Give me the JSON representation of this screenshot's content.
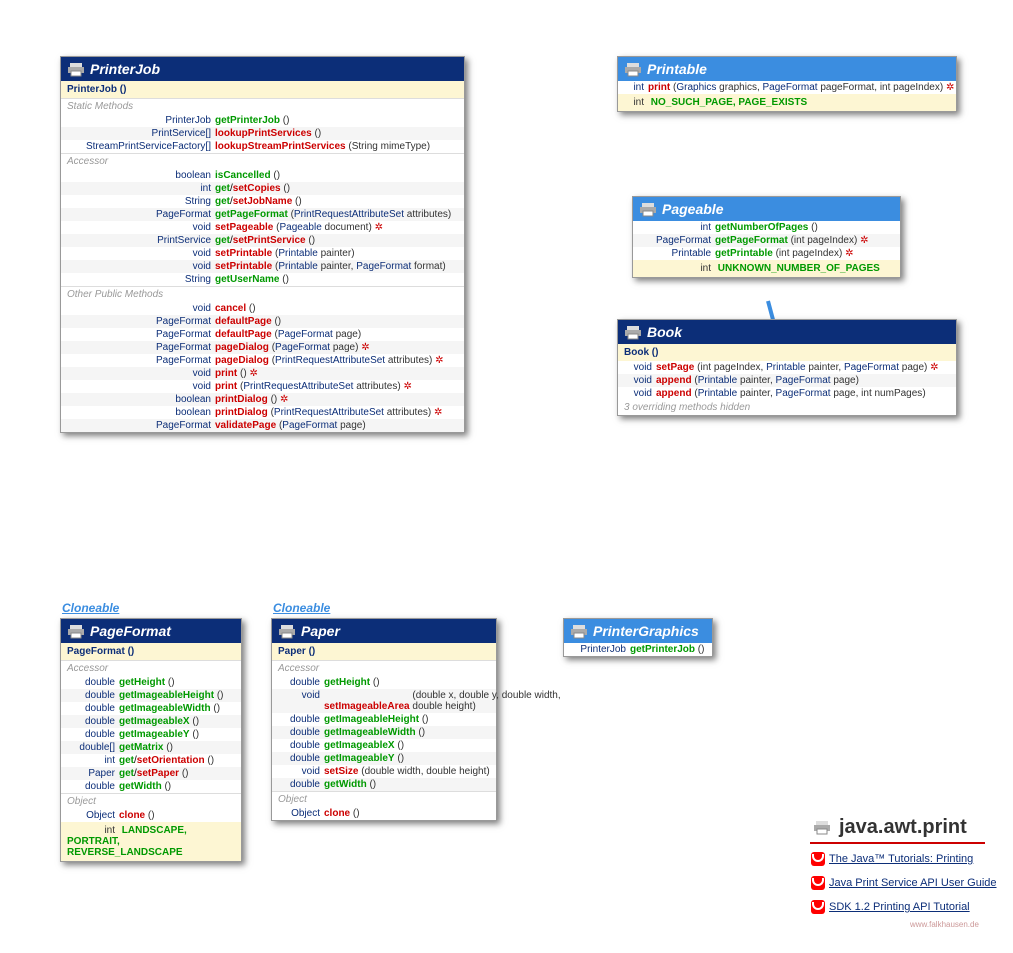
{
  "printerJob": {
    "title": "PrinterJob",
    "ctor": "PrinterJob ()",
    "static": [
      {
        "rt": "PrinterJob",
        "nm": "getPrinterJob",
        "args": "()"
      },
      {
        "rt": "PrintService[]",
        "nm": "lookupPrintServices",
        "args": "()"
      },
      {
        "rt": "StreamPrintServiceFactory[]",
        "nm": "lookupStreamPrintServices",
        "args": "(String mimeType)"
      }
    ],
    "acc": [
      {
        "rt": "boolean",
        "nm": "isCancelled",
        "args": "()"
      },
      {
        "rt": "int",
        "gs": "get/setCopies",
        "args": "()"
      },
      {
        "rt": "String",
        "gs": "get/setJobName",
        "args": "()"
      },
      {
        "rt": "PageFormat",
        "nm": "getPageFormat",
        "args": "(PrintRequestAttributeSet attributes)",
        "t": 1
      },
      {
        "rt": "void",
        "nm": "setPageable",
        "args": "(Pageable document)",
        "t": 1,
        "thr": 1
      },
      {
        "rt": "PrintService",
        "gs": "get/setPrintService",
        "args": "()"
      },
      {
        "rt": "void",
        "nm": "setPrintable",
        "args": "(Printable painter)",
        "t": 1
      },
      {
        "rt": "void",
        "nm": "setPrintable",
        "args": "(Printable painter, PageFormat format)",
        "t": 1
      },
      {
        "rt": "String",
        "nm": "getUserName",
        "args": "()"
      }
    ],
    "other": [
      {
        "rt": "void",
        "nm": "cancel",
        "args": "()"
      },
      {
        "rt": "PageFormat",
        "nm": "defaultPage",
        "args": "()"
      },
      {
        "rt": "PageFormat",
        "nm": "defaultPage",
        "args": "(PageFormat page)",
        "t": 1
      },
      {
        "rt": "PageFormat",
        "nm": "pageDialog",
        "args": "(PageFormat page)",
        "t": 1,
        "thr": 1
      },
      {
        "rt": "PageFormat",
        "nm": "pageDialog",
        "args": "(PrintRequestAttributeSet attributes)",
        "t": 1,
        "thr": 1
      },
      {
        "rt": "void",
        "nm": "print",
        "args": "()",
        "thr": 1
      },
      {
        "rt": "void",
        "nm": "print",
        "args": "(PrintRequestAttributeSet attributes)",
        "t": 1,
        "thr": 1
      },
      {
        "rt": "boolean",
        "nm": "printDialog",
        "args": "()",
        "thr": 1
      },
      {
        "rt": "boolean",
        "nm": "printDialog",
        "args": "(PrintRequestAttributeSet attributes)",
        "t": 1,
        "thr": 1
      },
      {
        "rt": "PageFormat",
        "nm": "validatePage",
        "args": "(PageFormat page)",
        "t": 1
      }
    ]
  },
  "printable": {
    "title": "Printable",
    "m": [
      {
        "rt": "int",
        "nm": "print",
        "args": "(Graphics graphics, PageFormat pageFormat, int pageIndex)",
        "t": 1,
        "thr": 1
      }
    ],
    "const": "NO_SUCH_PAGE, PAGE_EXISTS",
    "crt": "int"
  },
  "pageable": {
    "title": "Pageable",
    "m": [
      {
        "rt": "int",
        "nm": "getNumberOfPages",
        "args": "()"
      },
      {
        "rt": "PageFormat",
        "nm": "getPageFormat",
        "args": "(int pageIndex)",
        "thr": 1
      },
      {
        "rt": "Printable",
        "nm": "getPrintable",
        "args": "(int pageIndex)",
        "thr": 1
      }
    ],
    "const": "UNKNOWN_NUMBER_OF_PAGES",
    "crt": "int"
  },
  "book": {
    "title": "Book",
    "ctor": "Book ()",
    "m": [
      {
        "rt": "void",
        "nm": "setPage",
        "args": "(int pageIndex, Printable painter, PageFormat page)",
        "t": 1,
        "thr": 1
      },
      {
        "rt": "void",
        "nm": "append",
        "args": "(Printable painter, PageFormat page)",
        "t": 1
      },
      {
        "rt": "void",
        "nm": "append",
        "args": "(Printable painter, PageFormat page, int numPages)",
        "t": 1
      }
    ],
    "note": "3 overriding methods hidden"
  },
  "pageFormat": {
    "title": "PageFormat",
    "ctor": "PageFormat ()",
    "tag": "Cloneable",
    "acc": [
      {
        "rt": "double",
        "nm": "getHeight",
        "args": "()"
      },
      {
        "rt": "double",
        "nm": "getImageableHeight",
        "args": "()"
      },
      {
        "rt": "double",
        "nm": "getImageableWidth",
        "args": "()"
      },
      {
        "rt": "double",
        "nm": "getImageableX",
        "args": "()"
      },
      {
        "rt": "double",
        "nm": "getImageableY",
        "args": "()"
      },
      {
        "rt": "double[]",
        "nm": "getMatrix",
        "args": "()"
      },
      {
        "rt": "int",
        "gs": "get/setOrientation",
        "args": "()"
      },
      {
        "rt": "Paper",
        "gs": "get/setPaper",
        "args": "()"
      },
      {
        "rt": "double",
        "nm": "getWidth",
        "args": "()"
      }
    ],
    "obj": [
      {
        "rt": "Object",
        "nm": "clone",
        "args": "()"
      }
    ],
    "const": "LANDSCAPE, PORTRAIT, REVERSE_LANDSCAPE",
    "crt": "int"
  },
  "paper": {
    "title": "Paper",
    "ctor": "Paper ()",
    "tag": "Cloneable",
    "acc": [
      {
        "rt": "double",
        "nm": "getHeight",
        "args": "()"
      },
      {
        "rt": "void",
        "nm": "setImageableArea",
        "args": "(double x, double y, double width, double height)",
        "wrap": 1
      },
      {
        "rt": "double",
        "nm": "getImageableHeight",
        "args": "()"
      },
      {
        "rt": "double",
        "nm": "getImageableWidth",
        "args": "()"
      },
      {
        "rt": "double",
        "nm": "getImageableX",
        "args": "()"
      },
      {
        "rt": "double",
        "nm": "getImageableY",
        "args": "()"
      },
      {
        "rt": "void",
        "nm": "setSize",
        "args": "(double width, double height)"
      },
      {
        "rt": "double",
        "nm": "getWidth",
        "args": "()"
      }
    ],
    "obj": [
      {
        "rt": "Object",
        "nm": "clone",
        "args": "()"
      }
    ]
  },
  "printerGraphics": {
    "title": "PrinterGraphics",
    "m": [
      {
        "rt": "PrinterJob",
        "nm": "getPrinterJob",
        "args": "()"
      }
    ]
  },
  "labels": {
    "static": "Static Methods",
    "acc": "Accessor",
    "other": "Other Public Methods",
    "obj": "Object"
  },
  "pkg": "java.awt.print",
  "links": [
    "The Java™ Tutorials: Printing",
    "Java Print Service API User Guide",
    "SDK 1.2 Printing API Tutorial"
  ],
  "credit": "www.falkhausen.de"
}
